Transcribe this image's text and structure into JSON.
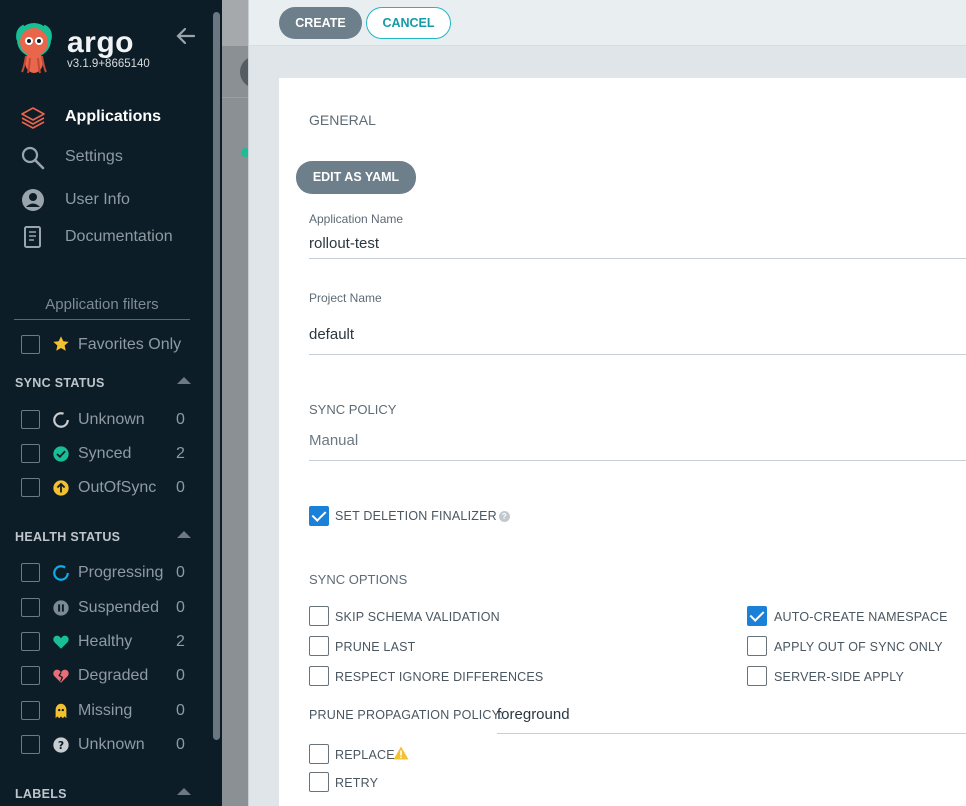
{
  "brand": {
    "name": "argo",
    "version": "v3.1.9+8665140"
  },
  "nav": [
    {
      "label": "Applications",
      "icon": "layers-icon",
      "active": true
    },
    {
      "label": "Settings",
      "icon": "search-icon"
    },
    {
      "label": "User Info",
      "icon": "user-icon"
    },
    {
      "label": "Documentation",
      "icon": "book-icon"
    }
  ],
  "filters": {
    "title": "Application filters",
    "favorites_label": "Favorites Only",
    "sync_status": {
      "title": "SYNC STATUS",
      "items": [
        {
          "label": "Unknown",
          "count": "0",
          "icon": "unknown-circle-icon"
        },
        {
          "label": "Synced",
          "count": "2",
          "icon": "check-circle-icon"
        },
        {
          "label": "OutOfSync",
          "count": "0",
          "icon": "arrow-up-circle-icon"
        }
      ]
    },
    "health_status": {
      "title": "HEALTH STATUS",
      "items": [
        {
          "label": "Progressing",
          "count": "0",
          "icon": "progress-circle-icon"
        },
        {
          "label": "Suspended",
          "count": "0",
          "icon": "pause-circle-icon"
        },
        {
          "label": "Healthy",
          "count": "2",
          "icon": "heart-icon"
        },
        {
          "label": "Degraded",
          "count": "0",
          "icon": "broken-heart-icon"
        },
        {
          "label": "Missing",
          "count": "0",
          "icon": "ghost-icon"
        },
        {
          "label": "Unknown",
          "count": "0",
          "icon": "question-circle-icon"
        }
      ]
    },
    "labels_title": "LABELS"
  },
  "toolbar": {
    "create_label": "CREATE",
    "cancel_label": "CANCEL"
  },
  "form": {
    "general_title": "GENERAL",
    "edit_yaml_label": "EDIT AS YAML",
    "app_name_caption": "Application Name",
    "app_name_value": "rollout-test",
    "project_caption": "Project Name",
    "project_value": "default",
    "sync_policy_title": "SYNC POLICY",
    "sync_policy_value": "Manual",
    "deletion_finalizer_label": "SET DELETION FINALIZER",
    "deletion_finalizer_checked": true,
    "sync_options_title": "SYNC OPTIONS",
    "sync_options": {
      "skip_schema": {
        "label": "SKIP SCHEMA VALIDATION",
        "checked": false
      },
      "prune_last": {
        "label": "PRUNE LAST",
        "checked": false
      },
      "respect_ignore": {
        "label": "RESPECT IGNORE DIFFERENCES",
        "checked": false
      },
      "auto_create_ns": {
        "label": "AUTO-CREATE NAMESPACE",
        "checked": true
      },
      "apply_out_of_sync": {
        "label": "APPLY OUT OF SYNC ONLY",
        "checked": false
      },
      "server_side": {
        "label": "SERVER-SIDE APPLY",
        "checked": false
      }
    },
    "prune_policy_caption": "PRUNE PROPAGATION POLICY:",
    "prune_policy_value": "foreground",
    "replace_label": "REPLACE",
    "retry_label": "RETRY"
  },
  "colors": {
    "sidebar_bg": "#0d1d28",
    "primary_button": "#6d7f8b",
    "cancel_accent": "#23b7c4",
    "checkbox_checked": "#1a80d8",
    "synced_green": "#18be94",
    "outofsync_yellow": "#f4c030",
    "healthy_green": "#18be94",
    "degraded_red": "#e96d76",
    "progressing_blue": "#0dadea",
    "star_yellow": "#f4c030"
  }
}
